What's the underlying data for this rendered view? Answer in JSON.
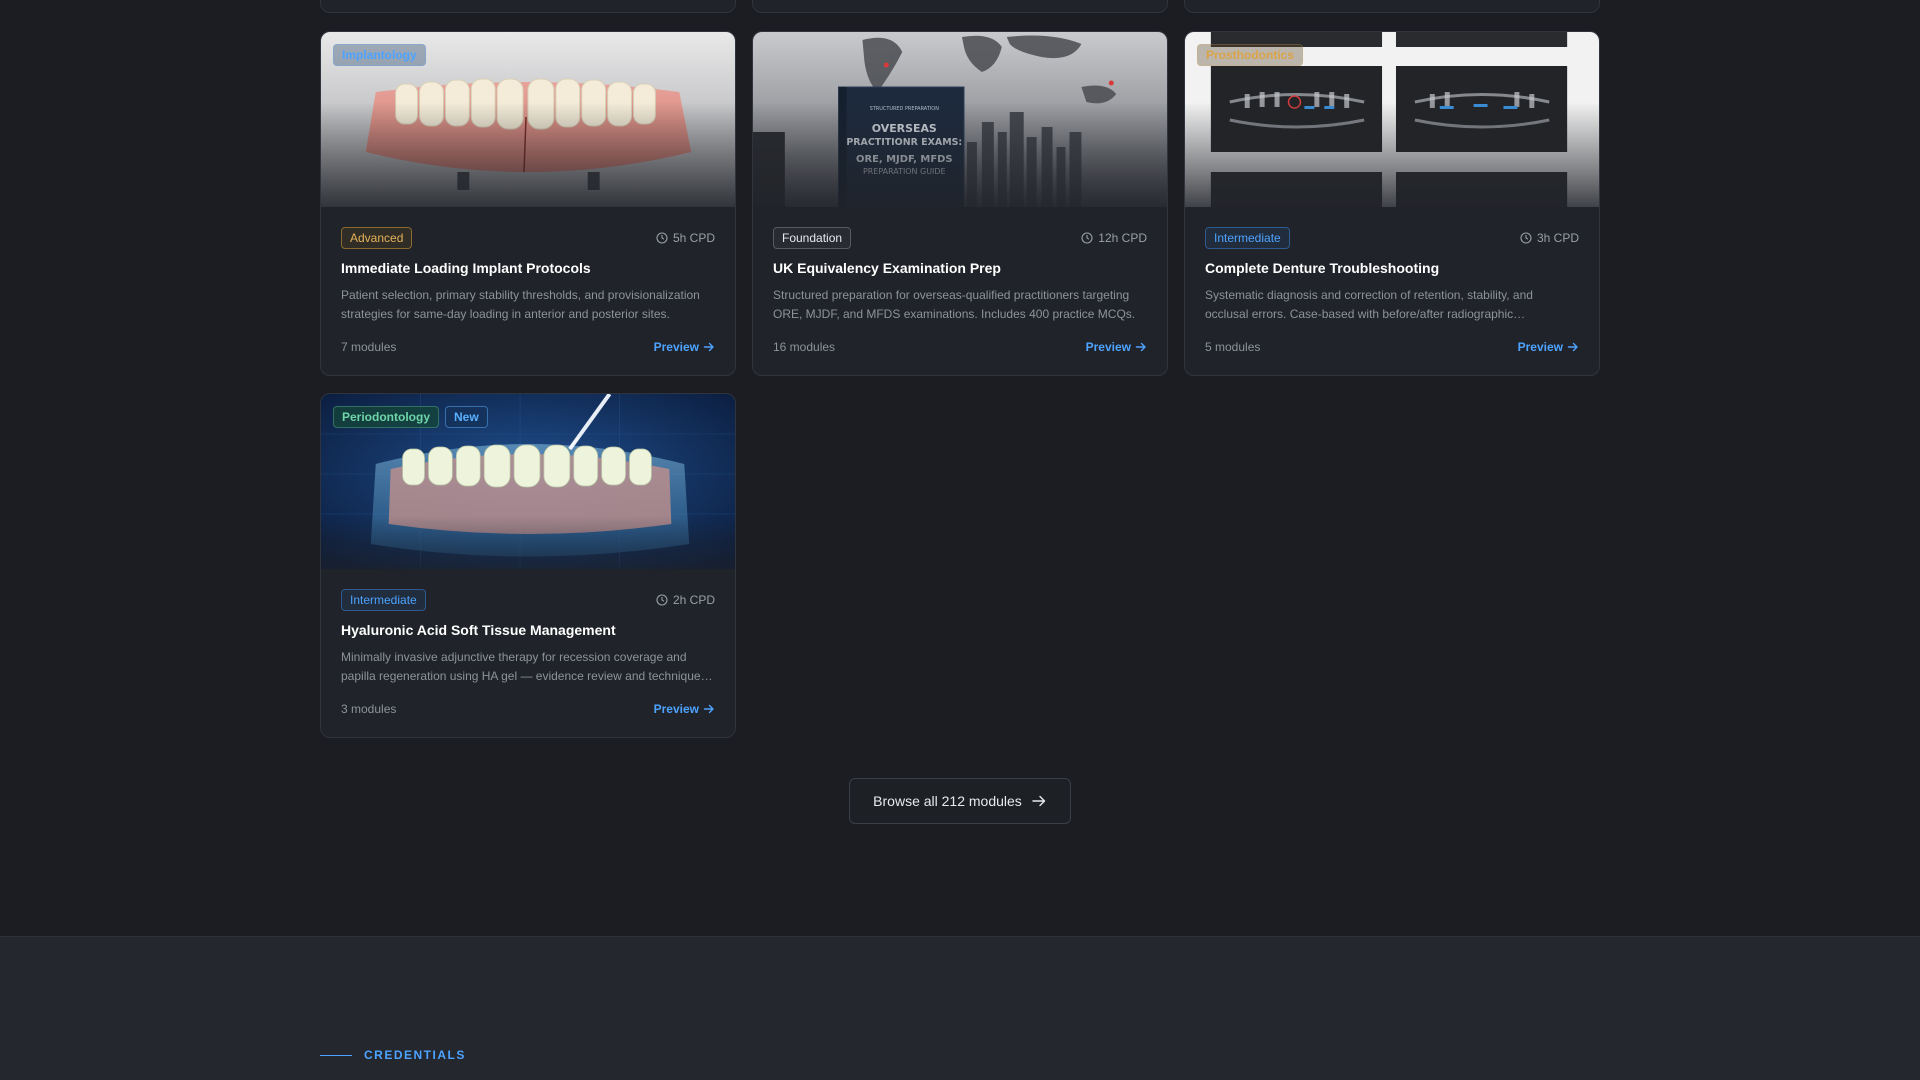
{
  "cards": [
    {
      "category": "Implantology",
      "level": "Advanced",
      "cpd": "5h CPD",
      "title": "Immediate Loading Implant Protocols",
      "description": "Patient selection, primary stability thresholds, and provisionalization strategies for same-day loading in anterior and posterior sites.",
      "modules": "7 modules",
      "preview_label": "Preview"
    },
    {
      "category": "",
      "level": "Foundation",
      "cpd": "12h CPD",
      "title": "UK Equivalency Examination Prep",
      "description": "Structured preparation for overseas-qualified practitioners targeting ORE, MJDF, and MFDS examinations. Includes 400 practice MCQs.",
      "modules": "16 modules",
      "preview_label": "Preview",
      "book": {
        "line1": "OVERSEAS",
        "line2": "PRACTITIONR EXAMS:",
        "line3": "ORE, MJDF, MFDS",
        "line4": "PREPARATION GUIDE"
      }
    },
    {
      "category": "Prosthodontics",
      "level": "Intermediate",
      "cpd": "3h CPD",
      "title": "Complete Denture Troubleshooting",
      "description": "Systematic diagnosis and correction of retention, stability, and occlusal errors. Case-based with before/after radiographic…",
      "modules": "5 modules",
      "preview_label": "Preview"
    },
    {
      "category": "Periodontology",
      "badge": "New",
      "level": "Intermediate",
      "cpd": "2h CPD",
      "title": "Hyaluronic Acid Soft Tissue Management",
      "description": "Minimally invasive adjunctive therapy for recession coverage and papilla regeneration using HA gel — evidence review and technique…",
      "modules": "3 modules",
      "preview_label": "Preview"
    }
  ],
  "browse_label": "Browse all 212 modules",
  "section_label": "CREDENTIALS",
  "colors": {
    "background": "#1b1d22",
    "card": "#202329",
    "accent": "#4da3ff",
    "advanced": "#e6b35a",
    "periodontology": "#6fd4a8",
    "prosthodontics": "#d9a44a"
  }
}
